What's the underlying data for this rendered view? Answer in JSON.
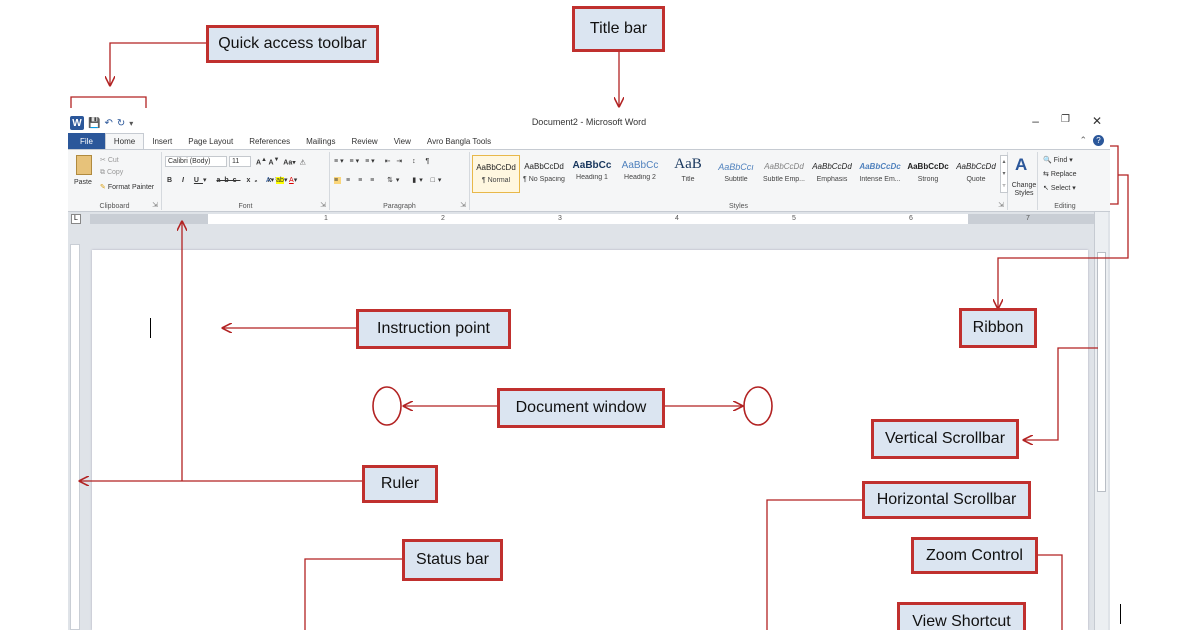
{
  "window": {
    "title": "Document2 - Microsoft Word",
    "controls": [
      "–",
      "❐",
      "✕"
    ]
  },
  "quick_access": {
    "logo": "W",
    "items": [
      "save-icon",
      "undo-icon",
      "redo-icon",
      "customize-icon"
    ]
  },
  "tabs": [
    {
      "label": "File"
    },
    {
      "label": "Home"
    },
    {
      "label": "Insert"
    },
    {
      "label": "Page Layout"
    },
    {
      "label": "References"
    },
    {
      "label": "Mailings"
    },
    {
      "label": "Review"
    },
    {
      "label": "View"
    },
    {
      "label": "Avro Bangla Tools"
    }
  ],
  "ribbon": {
    "clipboard": {
      "label": "Clipboard",
      "paste": "Paste",
      "cut": "Cut",
      "copy": "Copy",
      "format_painter": "Format Painter"
    },
    "font": {
      "label": "Font",
      "name": "Calibri (Body)",
      "size": "11"
    },
    "paragraph": {
      "label": "Paragraph"
    },
    "styles": {
      "label": "Styles",
      "items": [
        {
          "sample": "AaBbCcDd",
          "name": "¶ Normal"
        },
        {
          "sample": "AaBbCcDd",
          "name": "¶ No Spacing"
        },
        {
          "sample": "AaBbCc",
          "name": "Heading 1"
        },
        {
          "sample": "AaBbCc",
          "name": "Heading 2"
        },
        {
          "sample": "AaB",
          "name": "Title"
        },
        {
          "sample": "AaBbCcı",
          "name": "Subtitle"
        },
        {
          "sample": "AaBbCcDd",
          "name": "Subtle Emp..."
        },
        {
          "sample": "AaBbCcDd",
          "name": "Emphasis"
        },
        {
          "sample": "AaBbCcDc",
          "name": "Intense Em..."
        },
        {
          "sample": "AaBbCcDc",
          "name": "Strong"
        },
        {
          "sample": "AaBbCcDd",
          "name": "Quote"
        }
      ],
      "change_styles": "Change Styles"
    },
    "editing": {
      "label": "Editing",
      "find": "Find",
      "replace": "Replace",
      "select": "Select"
    }
  },
  "ruler": {
    "numbers": [
      "1",
      "2",
      "3",
      "4",
      "5",
      "6",
      "7"
    ]
  },
  "annotations": {
    "quick_access": "Quick access toolbar",
    "title_bar": "Title bar",
    "instruction_point": "Instruction point",
    "ribbon": "Ribbon",
    "document_window": "Document window",
    "vertical_scrollbar": "Vertical Scrollbar",
    "ruler": "Ruler",
    "horizontal_scrollbar": "Horizontal Scrollbar",
    "status_bar": "Status bar",
    "zoom_control": "Zoom Control",
    "view_shortcut": "View Shortcut"
  },
  "colors": {
    "callout_border": "#c0302e",
    "callout_fill": "#dbe5f1",
    "word_blue": "#2b579a"
  }
}
